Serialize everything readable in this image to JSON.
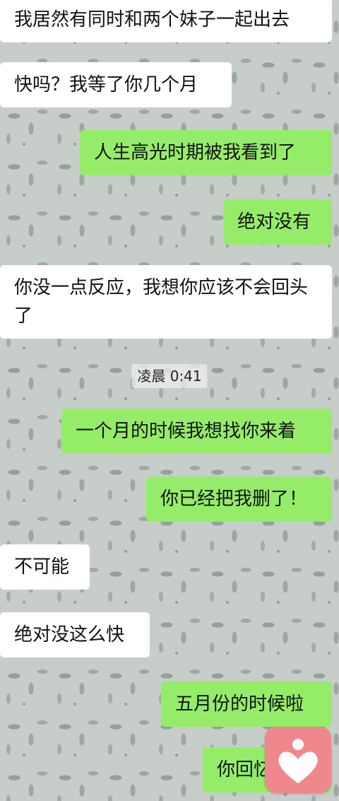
{
  "messages": [
    {
      "side": "in",
      "text": "我居然有同时和两个妹子一起出去"
    },
    {
      "side": "in",
      "text": "快吗？我等了你几个月"
    },
    {
      "side": "out",
      "text": "人生高光时期被我看到了"
    },
    {
      "side": "out",
      "text": "绝对没有"
    },
    {
      "side": "in",
      "text": "你没一点反应，我想你应该不会回头了"
    },
    {
      "side": "out",
      "text": "一个月的时候我想找你来着"
    },
    {
      "side": "out",
      "text": "你已经把我删了！"
    },
    {
      "side": "in",
      "text": "不可能"
    },
    {
      "side": "in",
      "text": "绝对没这么快"
    },
    {
      "side": "out",
      "text": "五月份的时候啦"
    },
    {
      "side": "out",
      "text": "你回忆"
    }
  ],
  "timestamp": "凌晨 0:41",
  "favorite_icon": "heart-person-icon",
  "colors": {
    "incoming_bubble": "#ffffff",
    "outgoing_bubble": "#95ec69",
    "favorite_badge": "#f0878c"
  }
}
